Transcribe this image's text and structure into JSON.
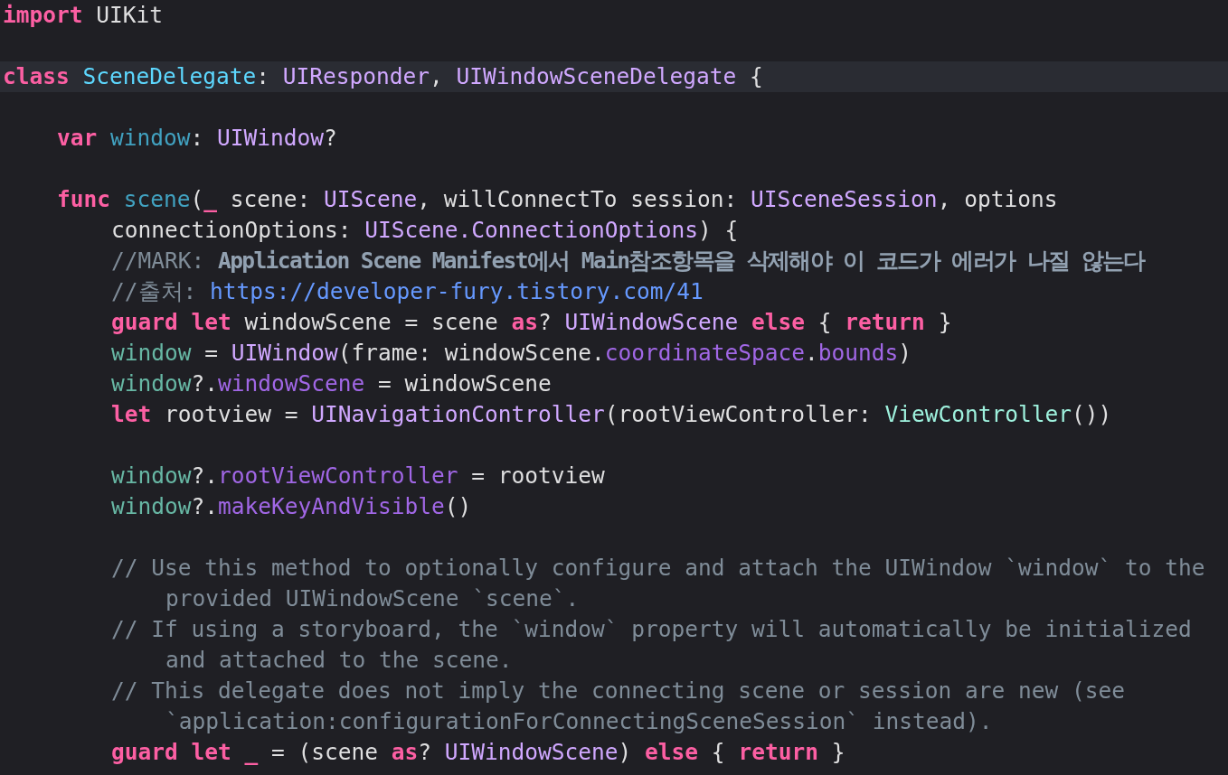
{
  "editor": {
    "lines": [
      {
        "current": false,
        "tokens": [
          {
            "kind": "keyword",
            "text": "import"
          },
          {
            "kind": "plain",
            "text": " UIKit"
          }
        ]
      },
      {
        "current": false
      },
      {
        "current": true,
        "tokens": [
          {
            "kind": "keyword",
            "text": "class "
          },
          {
            "kind": "class-name",
            "text": "SceneDelegate"
          },
          {
            "kind": "plain",
            "text": ": "
          },
          {
            "kind": "type",
            "text": "UIResponder"
          },
          {
            "kind": "plain",
            "text": ", "
          },
          {
            "kind": "type",
            "text": "UIWindowSceneDelegate"
          },
          {
            "kind": "plain",
            "text": " {"
          }
        ],
        "children": [
          {
            "current": false
          },
          {
            "current": false,
            "tokens": [
              {
                "kind": "keyword",
                "text": "var "
              },
              {
                "kind": "decl",
                "text": "window"
              },
              {
                "kind": "plain",
                "text": ": "
              },
              {
                "kind": "type",
                "text": "UIWindow"
              },
              {
                "kind": "plain",
                "text": "?"
              }
            ]
          },
          {
            "current": false
          },
          {
            "current": false,
            "tokens": [
              {
                "kind": "keyword",
                "text": "func "
              },
              {
                "kind": "decl",
                "text": "scene"
              },
              {
                "kind": "plain",
                "text": "("
              },
              {
                "kind": "keyword",
                "text": "_"
              },
              {
                "kind": "plain",
                "text": " scene: "
              },
              {
                "kind": "type",
                "text": "UIScene"
              },
              {
                "kind": "plain",
                "text": ", willConnectTo session: "
              },
              {
                "kind": "type",
                "text": "UISceneSession"
              },
              {
                "kind": "plain",
                "text": ", options"
              }
            ],
            "children": [
              {
                "current": false,
                "tokens": [
                  {
                    "kind": "plain",
                    "text": "connectionOptions: "
                  },
                  {
                    "kind": "type",
                    "text": "UIScene.ConnectionOptions"
                  },
                  {
                    "kind": "plain",
                    "text": ") {"
                  }
                ]
              },
              {
                "current": false,
                "tokens": [
                  {
                    "kind": "comment",
                    "text": "//MARK: "
                  },
                  {
                    "kind": "mark",
                    "text": "Application Scene Manifest에서 Main참조항목을 삭제해야 이 코드가 에러가 나질 않는다"
                  }
                ]
              },
              {
                "current": false,
                "tokens": [
                  {
                    "kind": "comment",
                    "text": "//출처: "
                  },
                  {
                    "kind": "link",
                    "text": "https://developer-fury.tistory.com/41"
                  }
                ]
              },
              {
                "current": false,
                "tokens": [
                  {
                    "kind": "keyword",
                    "text": "guard let"
                  },
                  {
                    "kind": "plain",
                    "text": " windowScene = scene "
                  },
                  {
                    "kind": "keyword",
                    "text": "as"
                  },
                  {
                    "kind": "plain",
                    "text": "? "
                  },
                  {
                    "kind": "type",
                    "text": "UIWindowScene"
                  },
                  {
                    "kind": "keyword",
                    "text": " else"
                  },
                  {
                    "kind": "plain",
                    "text": " { "
                  },
                  {
                    "kind": "keyword",
                    "text": "return"
                  },
                  {
                    "kind": "plain",
                    "text": " }"
                  }
                ]
              },
              {
                "current": false,
                "tokens": [
                  {
                    "kind": "local",
                    "text": "window"
                  },
                  {
                    "kind": "plain",
                    "text": " = "
                  },
                  {
                    "kind": "type",
                    "text": "UIWindow"
                  },
                  {
                    "kind": "plain",
                    "text": "(frame: windowScene."
                  },
                  {
                    "kind": "member",
                    "text": "coordinateSpace"
                  },
                  {
                    "kind": "plain",
                    "text": "."
                  },
                  {
                    "kind": "member",
                    "text": "bounds"
                  },
                  {
                    "kind": "plain",
                    "text": ")"
                  }
                ]
              },
              {
                "current": false,
                "tokens": [
                  {
                    "kind": "local",
                    "text": "window"
                  },
                  {
                    "kind": "plain",
                    "text": "?."
                  },
                  {
                    "kind": "member",
                    "text": "windowScene"
                  },
                  {
                    "kind": "plain",
                    "text": " = windowScene"
                  }
                ]
              },
              {
                "current": false,
                "tokens": [
                  {
                    "kind": "keyword",
                    "text": "let"
                  },
                  {
                    "kind": "plain",
                    "text": " rootview = "
                  },
                  {
                    "kind": "type",
                    "text": "UINavigationController"
                  },
                  {
                    "kind": "plain",
                    "text": "(rootViewController: "
                  },
                  {
                    "kind": "project-type",
                    "text": "ViewController"
                  },
                  {
                    "kind": "plain",
                    "text": "())"
                  }
                ]
              },
              {
                "current": false
              },
              {
                "current": false,
                "tokens": [
                  {
                    "kind": "local",
                    "text": "window"
                  },
                  {
                    "kind": "plain",
                    "text": "?."
                  },
                  {
                    "kind": "member",
                    "text": "rootViewController"
                  },
                  {
                    "kind": "plain",
                    "text": " = rootview"
                  }
                ]
              },
              {
                "current": false,
                "tokens": [
                  {
                    "kind": "local",
                    "text": "window"
                  },
                  {
                    "kind": "plain",
                    "text": "?."
                  },
                  {
                    "kind": "member",
                    "text": "makeKeyAndVisible"
                  },
                  {
                    "kind": "plain",
                    "text": "()"
                  }
                ]
              },
              {
                "current": false
              },
              {
                "current": false,
                "tokens": [
                  {
                    "kind": "comment",
                    "text": "// Use this method to optionally configure and attach the UIWindow `window` to the"
                  }
                ],
                "children": [
                  {
                    "current": false,
                    "tokens": [
                      {
                        "kind": "comment",
                        "text": "provided UIWindowScene `scene`."
                      }
                    ]
                  }
                ]
              },
              {
                "current": false,
                "tokens": [
                  {
                    "kind": "comment",
                    "text": "// If using a storyboard, the `window` property will automatically be initialized"
                  }
                ],
                "children": [
                  {
                    "current": false,
                    "tokens": [
                      {
                        "kind": "comment",
                        "text": "and attached to the scene."
                      }
                    ]
                  }
                ]
              },
              {
                "current": false,
                "tokens": [
                  {
                    "kind": "comment",
                    "text": "// This delegate does not imply the connecting scene or session are new (see"
                  }
                ],
                "children": [
                  {
                    "current": false,
                    "tokens": [
                      {
                        "kind": "comment",
                        "text": "`application:configurationForConnectingSceneSession` instead)."
                      }
                    ]
                  }
                ]
              },
              {
                "current": false,
                "tokens": [
                  {
                    "kind": "keyword",
                    "text": "guard let _"
                  },
                  {
                    "kind": "plain",
                    "text": " = (scene "
                  },
                  {
                    "kind": "keyword",
                    "text": "as"
                  },
                  {
                    "kind": "plain",
                    "text": "? "
                  },
                  {
                    "kind": "type",
                    "text": "UIWindowScene"
                  },
                  {
                    "kind": "plain",
                    "text": ") "
                  },
                  {
                    "kind": "keyword",
                    "text": "else"
                  },
                  {
                    "kind": "plain",
                    "text": " { "
                  },
                  {
                    "kind": "keyword",
                    "text": "return"
                  },
                  {
                    "kind": "plain",
                    "text": " }"
                  }
                ]
              }
            ]
          }
        ]
      }
    ]
  }
}
